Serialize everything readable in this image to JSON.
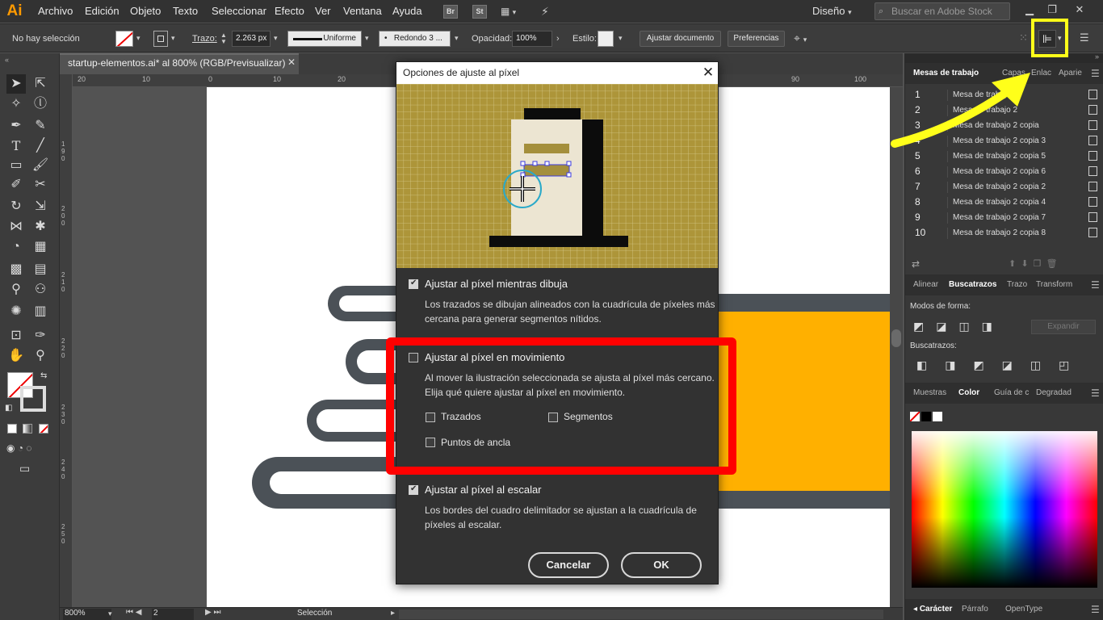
{
  "app": {
    "logo": "Ai",
    "accent": "#ff9a00"
  },
  "menubar": {
    "items": [
      "Archivo",
      "Edición",
      "Objeto",
      "Texto",
      "Seleccionar",
      "Efecto",
      "Ver",
      "Ventana",
      "Ayuda"
    ],
    "bridge_label": "Br",
    "stock_label": "St",
    "workspace": "Diseño",
    "search_placeholder": "Buscar en Adobe Stock"
  },
  "controlbar": {
    "selection_text": "No hay selección",
    "stroke_label": "Trazo:",
    "stroke_value": "2.263 px",
    "stroke_profile": "Uniforme",
    "brush": "Redondo 3 ...",
    "opacity_label": "Opacidad:",
    "opacity_value": "100%",
    "style_label": "Estilo:",
    "fit_document_button": "Ajustar documento",
    "preferences_button": "Preferencias"
  },
  "document": {
    "tab_title": "startup-elementos.ai* al 800% (RGB/Previsualizar)",
    "zoom": "800%",
    "artboard_page": "2",
    "status_tool": "Selección",
    "ruler_top_ticks": [
      "20",
      "10",
      "0",
      "10",
      "20",
      "30",
      "40",
      "50",
      "60",
      "70",
      "80",
      "90",
      "100"
    ],
    "ruler_left_ticks": [
      "1 9 0",
      "2 0 0",
      "2 1 0",
      "2 2 0",
      "2 3 0",
      "2 4 0",
      "2 5 0"
    ]
  },
  "panels": {
    "artboards_tabs": [
      "Mesas de trabajo",
      "Capas",
      "Enlac",
      "Aparie"
    ],
    "artboards": [
      {
        "num": "1",
        "name": "Mesa de trabajo 1"
      },
      {
        "num": "2",
        "name": "Mesa de trabajo 2"
      },
      {
        "num": "3",
        "name": "Mesa de trabajo 2 copia"
      },
      {
        "num": "4",
        "name": "Mesa de trabajo 2 copia 3"
      },
      {
        "num": "5",
        "name": "Mesa de trabajo 2 copia 5"
      },
      {
        "num": "6",
        "name": "Mesa de trabajo 2 copia 6"
      },
      {
        "num": "7",
        "name": "Mesa de trabajo 2 copia 2"
      },
      {
        "num": "8",
        "name": "Mesa de trabajo 2 copia 4"
      },
      {
        "num": "9",
        "name": "Mesa de trabajo 2 copia 7"
      },
      {
        "num": "10",
        "name": "Mesa de trabajo 2 copia 8"
      }
    ],
    "pathfinder_tabs": [
      "Alinear",
      "Buscatrazos",
      "Trazo",
      "Transform"
    ],
    "shape_modes_label": "Modos de forma:",
    "expand_button": "Expandir",
    "pathfinders_label": "Buscatrazos:",
    "color_tabs": [
      "Muestras",
      "Color",
      "Guía de c",
      "Degradad"
    ],
    "bottom_tabs": [
      "Carácter",
      "Párrafo",
      "OpenType"
    ]
  },
  "dialog": {
    "title": "Opciones de ajuste al píxel",
    "option1": {
      "label": "Ajustar al píxel mientras dibuja",
      "checked": true,
      "desc": "Los trazados se dibujan alineados con la cuadrícula de píxeles más cercana para generar segmentos nítidos."
    },
    "option2": {
      "label": "Ajustar al píxel en movimiento",
      "checked": false,
      "desc": "Al mover la ilustración seleccionada se ajusta al píxel más cercano. Elija qué quiere ajustar al píxel en movimiento.",
      "sub_paths": "Trazados",
      "sub_segments": "Segmentos",
      "sub_anchors": "Puntos de ancla"
    },
    "option3": {
      "label": "Ajustar al píxel al escalar",
      "checked": true,
      "desc": "Los bordes del cuadro delimitador se ajustan a la cuadrícula de píxeles al escalar."
    },
    "cancel_button": "Cancelar",
    "ok_button": "OK"
  },
  "annotations": {
    "red_box_color": "#ff0000",
    "yellow_box_color": "#ffff1a"
  }
}
